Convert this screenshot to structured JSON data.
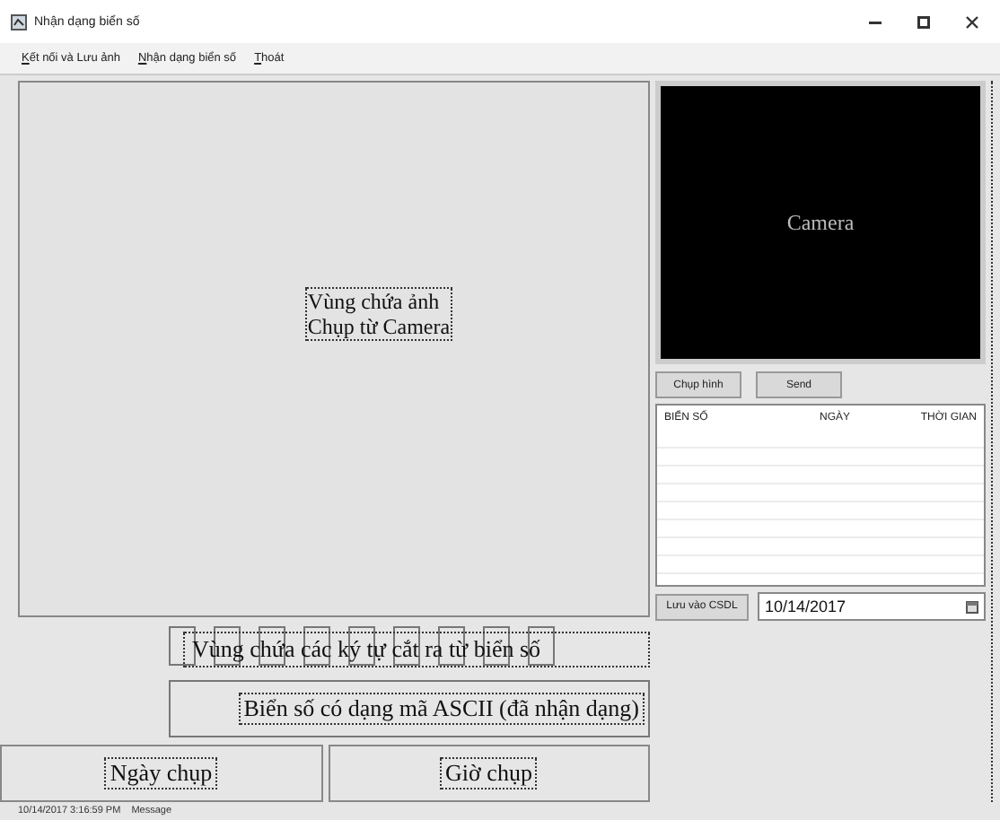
{
  "window": {
    "title": "Nhận dạng biển số"
  },
  "menu": [
    "Kết nối và Lưu ảnh",
    "Nhận dạng biển số",
    "Thoát"
  ],
  "image_area": {
    "label_lines": [
      "Vùng chứa ảnh",
      "Chụp từ Camera"
    ]
  },
  "camera": {
    "label": "Camera"
  },
  "camera_buttons": [
    "Chụp hình",
    "Send"
  ],
  "table": {
    "columns": [
      "BIỂN SỐ",
      "NGÀY",
      "THỜI GIAN"
    ]
  },
  "save_button": "Lưu vào CSDL",
  "date_picker": {
    "value": "10/14/2017"
  },
  "characters": {
    "label": "Vùng chứa các ký tự cắt ra từ biển số"
  },
  "plate_text": "Biển số có dạng mã ASCII (đã nhận dạng)",
  "date_label": "Ngày chụp",
  "time_label": "Giờ chụp",
  "status_bar": {
    "timestamp": "10/14/2017 3:16:59 PM",
    "message": "Message"
  }
}
